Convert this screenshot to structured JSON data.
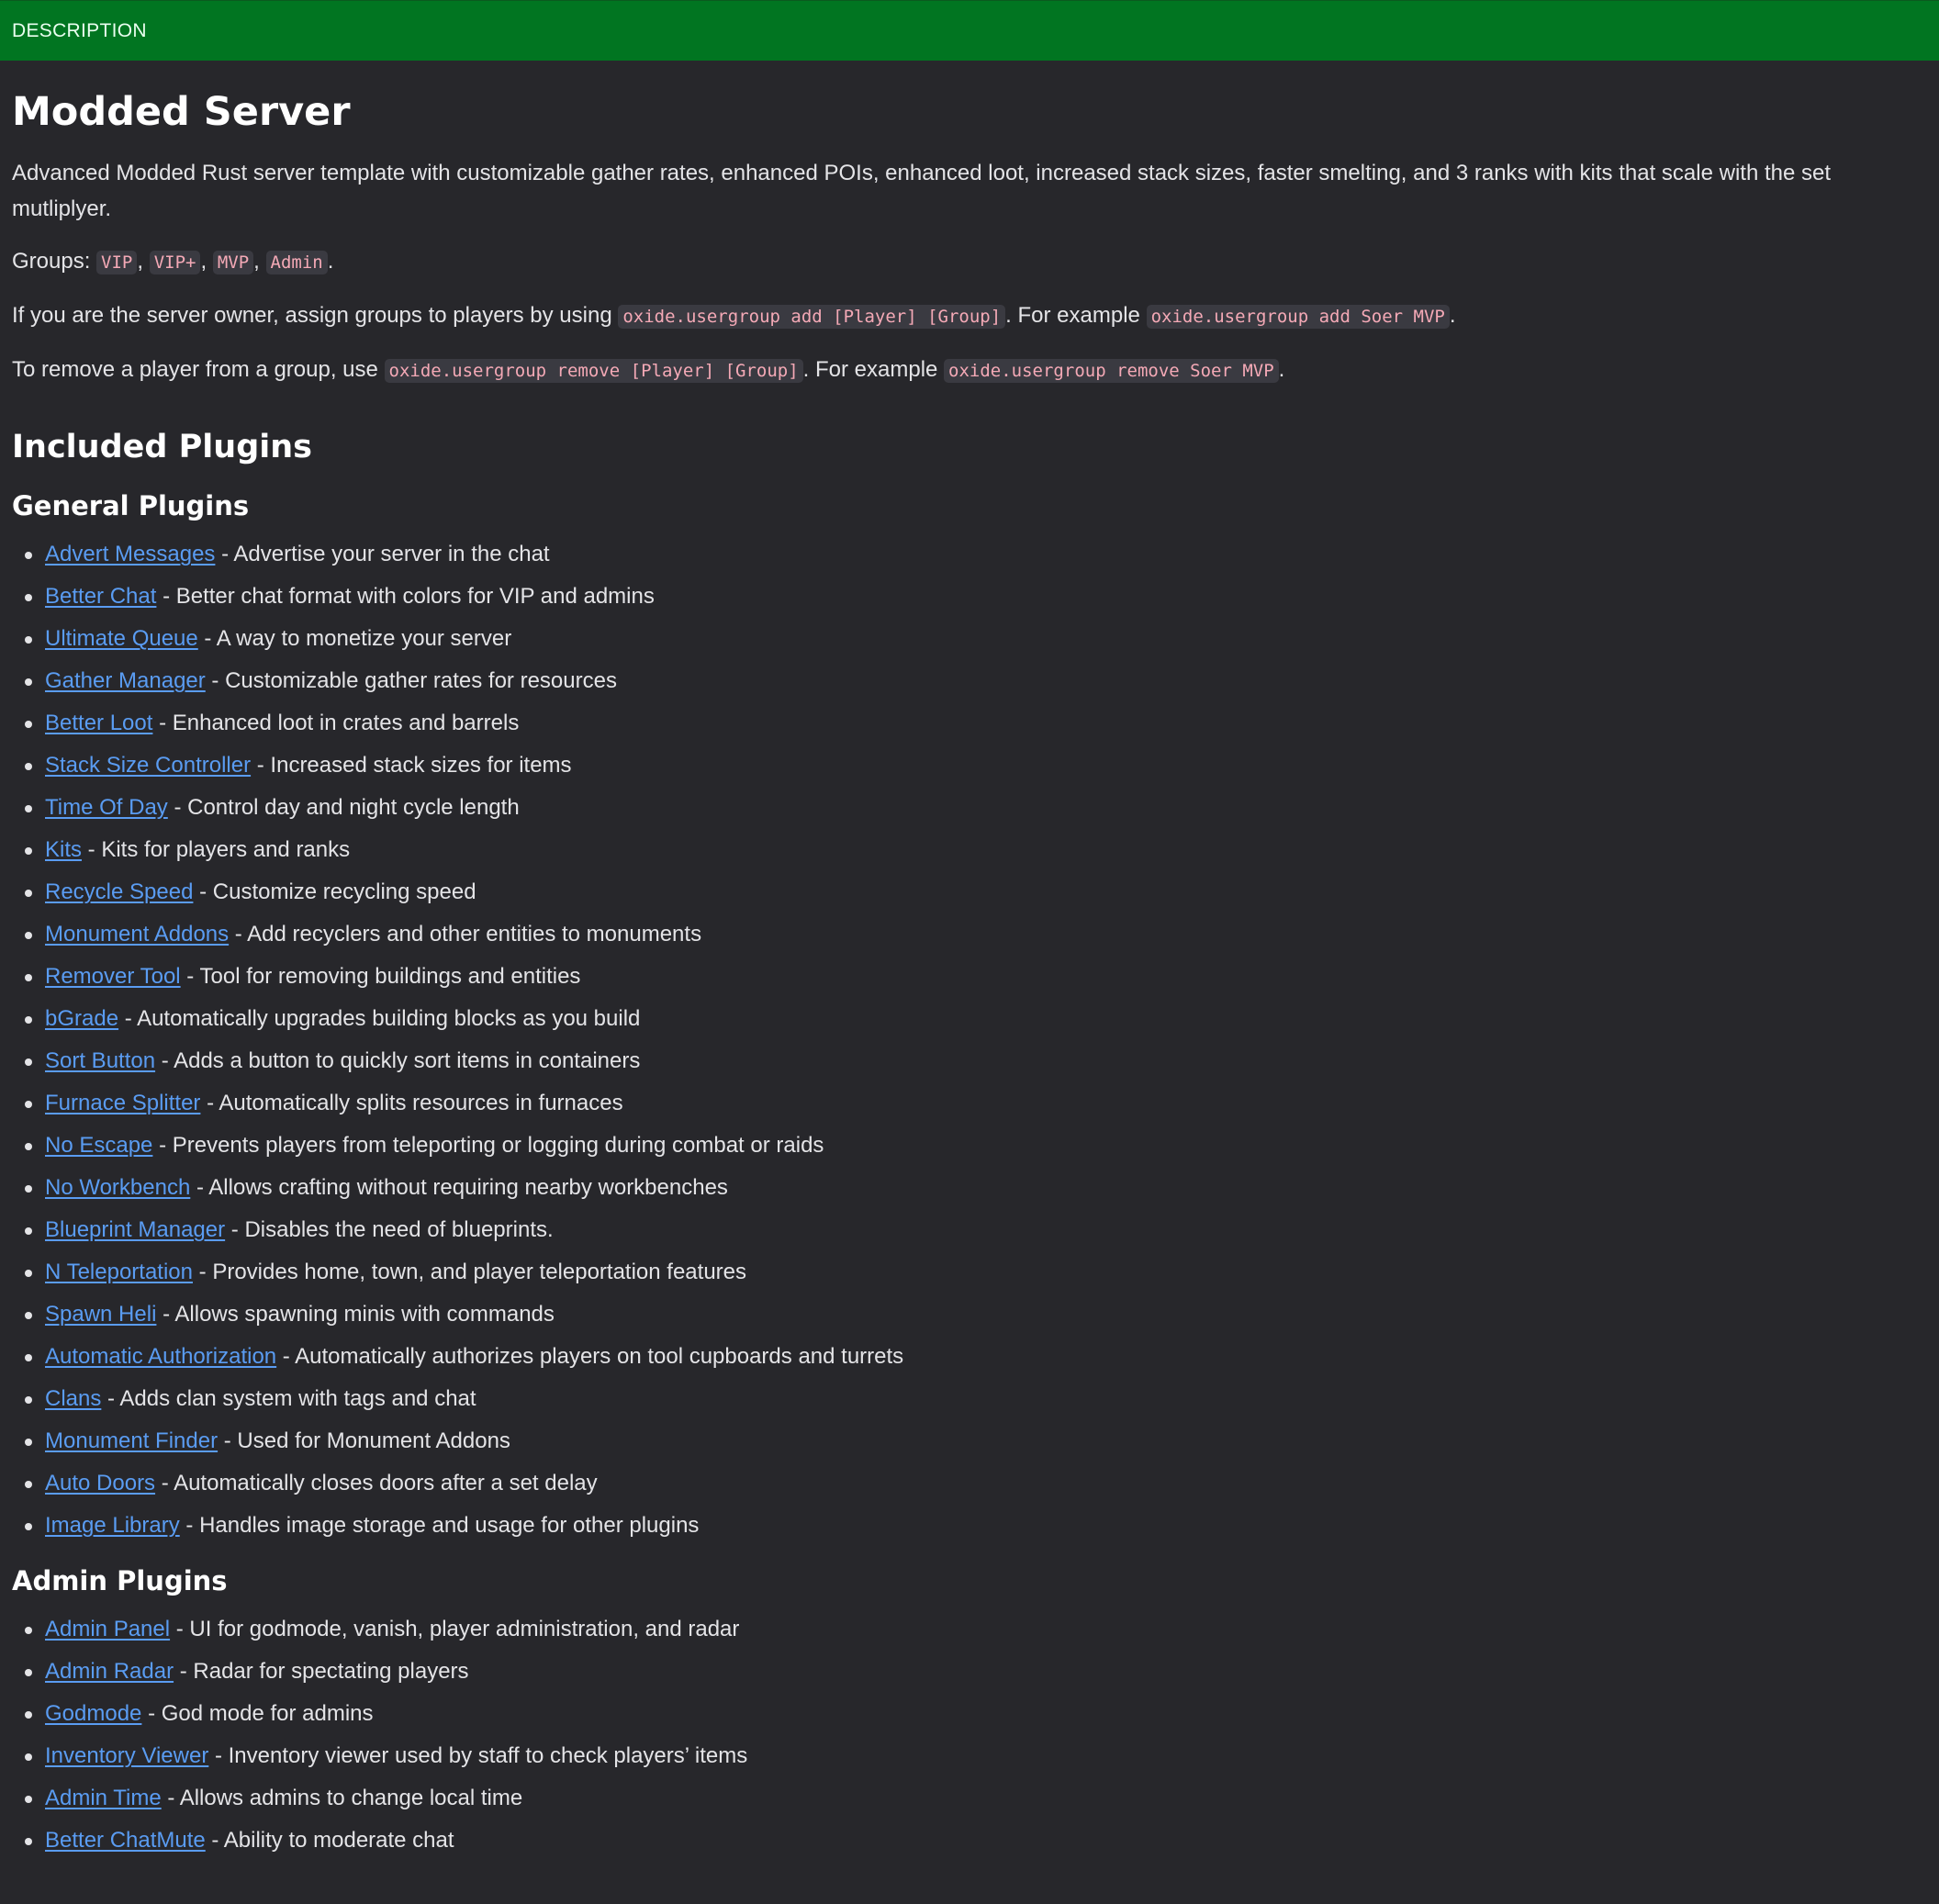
{
  "header": {
    "label": "DESCRIPTION"
  },
  "title": "Modded Server",
  "intro": "Advanced Modded Rust server template with customizable gather rates, enhanced POIs, enhanced loot, increased stack sizes, faster smelting, and 3 ranks with kits that scale with the set mutliplyer.",
  "groups_line": {
    "prefix": "Groups: ",
    "groups": [
      "VIP",
      "VIP+",
      "MVP",
      "Admin"
    ],
    "sep": ", ",
    "suffix": "."
  },
  "assign_line": {
    "text1": "If you are the server owner, assign groups to players by using ",
    "code1": "oxide.usergroup add [Player] [Group]",
    "text2": ". For example ",
    "code2": "oxide.usergroup add Soer MVP",
    "text3": "."
  },
  "remove_line": {
    "text1": "To remove a player from a group, use ",
    "code1": "oxide.usergroup remove [Player] [Group]",
    "text2": ". For example ",
    "code2": "oxide.usergroup remove Soer MVP",
    "text3": "."
  },
  "included_heading": "Included Plugins",
  "general_heading": "General Plugins",
  "general_plugins": [
    {
      "name": "Advert Messages",
      "desc": " - Advertise your server in the chat"
    },
    {
      "name": "Better Chat",
      "desc": " - Better chat format with colors for VIP and admins"
    },
    {
      "name": "Ultimate Queue",
      "desc": " - A way to monetize your server"
    },
    {
      "name": "Gather Manager",
      "desc": " - Customizable gather rates for resources"
    },
    {
      "name": "Better Loot",
      "desc": " - Enhanced loot in crates and barrels"
    },
    {
      "name": "Stack Size Controller",
      "desc": " - Increased stack sizes for items"
    },
    {
      "name": "Time Of Day",
      "desc": " - Control day and night cycle length"
    },
    {
      "name": "Kits",
      "desc": " - Kits for players and ranks"
    },
    {
      "name": "Recycle Speed",
      "desc": " - Customize recycling speed"
    },
    {
      "name": "Monument Addons",
      "desc": " - Add recyclers and other entities to monuments"
    },
    {
      "name": "Remover Tool",
      "desc": " - Tool for removing buildings and entities"
    },
    {
      "name": "bGrade",
      "desc": " - Automatically upgrades building blocks as you build"
    },
    {
      "name": "Sort Button",
      "desc": " - Adds a button to quickly sort items in containers"
    },
    {
      "name": "Furnace Splitter",
      "desc": " - Automatically splits resources in furnaces"
    },
    {
      "name": "No Escape",
      "desc": " - Prevents players from teleporting or logging during combat or raids"
    },
    {
      "name": "No Workbench",
      "desc": " - Allows crafting without requiring nearby workbenches"
    },
    {
      "name": "Blueprint Manager",
      "desc": " - Disables the need of blueprints."
    },
    {
      "name": "N Teleportation",
      "desc": " - Provides home, town, and player teleportation features"
    },
    {
      "name": "Spawn Heli",
      "desc": " - Allows spawning minis with commands"
    },
    {
      "name": "Automatic Authorization",
      "desc": " - Automatically authorizes players on tool cupboards and turrets"
    },
    {
      "name": "Clans",
      "desc": " - Adds clan system with tags and chat"
    },
    {
      "name": "Monument Finder",
      "desc": " - Used for Monument Addons"
    },
    {
      "name": "Auto Doors",
      "desc": " - Automatically closes doors after a set delay"
    },
    {
      "name": "Image Library",
      "desc": " - Handles image storage and usage for other plugins"
    }
  ],
  "admin_heading": "Admin Plugins",
  "admin_plugins": [
    {
      "name": "Admin Panel",
      "desc": " - UI for godmode, vanish, player administration, and radar"
    },
    {
      "name": "Admin Radar",
      "desc": " - Radar for spectating players"
    },
    {
      "name": "Godmode",
      "desc": " - God mode for admins"
    },
    {
      "name": "Inventory Viewer",
      "desc": " - Inventory viewer used by staff to check players’ items"
    },
    {
      "name": "Admin Time",
      "desc": " - Allows admins to change local time"
    },
    {
      "name": "Better ChatMute",
      "desc": " - Ability to moderate chat"
    }
  ],
  "colors": {
    "header_bg": "#017521",
    "page_bg": "#27272b",
    "link": "#5a9cf2",
    "code_text": "#f4a9b6",
    "code_bg": "#3a3a41"
  }
}
